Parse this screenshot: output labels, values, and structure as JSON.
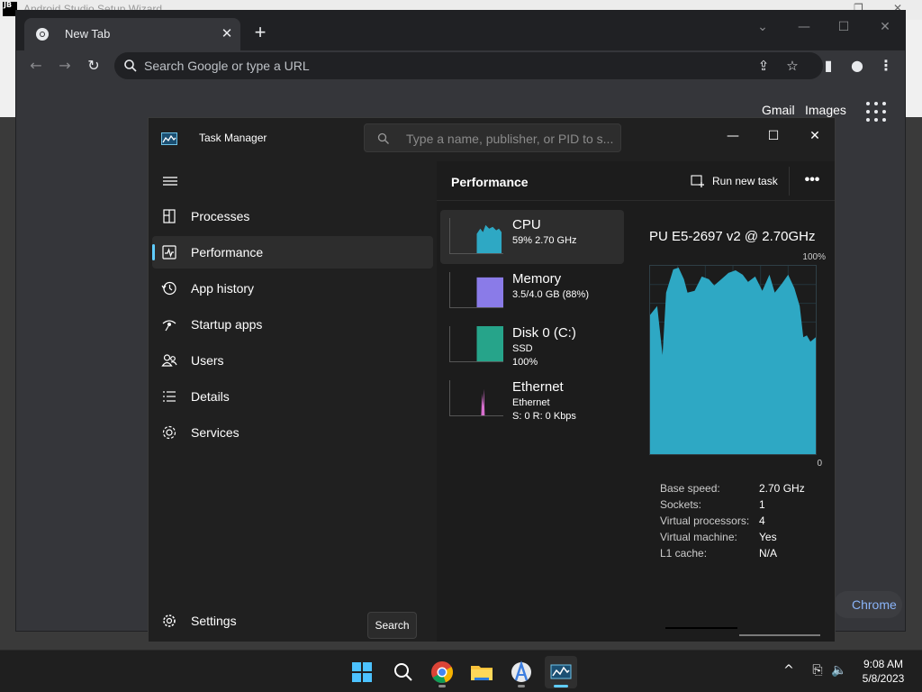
{
  "background_app": {
    "title": "Android Studio Setup Wizard",
    "logo_text": "JB"
  },
  "chrome": {
    "tab_title": "New Tab",
    "omnibox_placeholder": "Search Google or type a URL",
    "links": {
      "gmail": "Gmail",
      "images": "Images"
    },
    "customize_label": "Chrome"
  },
  "task_manager": {
    "title": "Task Manager",
    "search_placeholder": "Type a name, publisher, or PID to s...",
    "nav": [
      {
        "label": "Processes",
        "icon": "processes-icon"
      },
      {
        "label": "Performance",
        "icon": "performance-icon",
        "active": true
      },
      {
        "label": "App history",
        "icon": "app-history-icon"
      },
      {
        "label": "Startup apps",
        "icon": "startup-apps-icon"
      },
      {
        "label": "Users",
        "icon": "users-icon"
      },
      {
        "label": "Details",
        "icon": "details-icon"
      },
      {
        "label": "Services",
        "icon": "services-icon"
      }
    ],
    "settings_label": "Settings",
    "tooltip": "Search",
    "header": {
      "title": "Performance",
      "run_new_task": "Run new task"
    },
    "resources": [
      {
        "name": "CPU",
        "sub": [
          "59%  2.70 GHz"
        ],
        "color": "#2ea8c4"
      },
      {
        "name": "Memory",
        "sub": [
          "3.5/4.0 GB (88%)"
        ],
        "color": "#8a7be8"
      },
      {
        "name": "Disk 0 (C:)",
        "sub": [
          "SSD",
          "100%"
        ],
        "color": "#26a48a"
      },
      {
        "name": "Ethernet",
        "sub": [
          "Ethernet",
          "S: 0  R: 0 Kbps"
        ],
        "color": "#d86fcf"
      }
    ],
    "detail": {
      "processor": "PU E5-2697 v2 @ 2.70GHz",
      "max_label": "100%",
      "min_label": "0",
      "stats": [
        {
          "key": "Base speed:",
          "value": "2.70 GHz"
        },
        {
          "key": "Sockets:",
          "value": "1"
        },
        {
          "key": "Virtual processors:",
          "value": "4"
        },
        {
          "key": "Virtual machine:",
          "value": "Yes"
        },
        {
          "key": "L1 cache:",
          "value": "N/A"
        }
      ]
    }
  },
  "taskbar": {
    "time": "9:08 AM",
    "date": "5/8/2023"
  }
}
